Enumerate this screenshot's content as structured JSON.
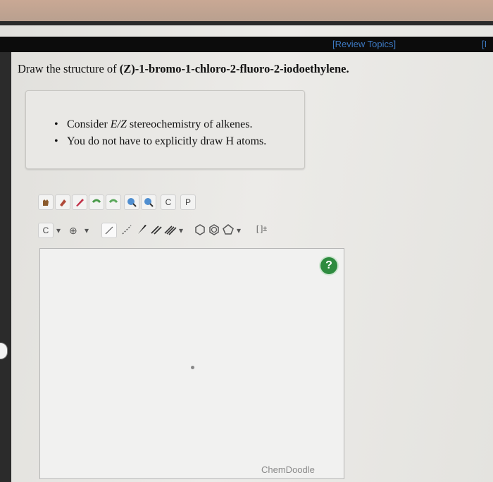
{
  "header": {
    "review_topics": "[Review Topics]",
    "edge_text": "[I"
  },
  "question": {
    "prefix": "Draw the structure of ",
    "compound": "(Z)-1-bromo-1-chloro-2-fluoro-2-iodoethylene."
  },
  "hints": [
    {
      "pre": "Consider ",
      "em": "E/Z",
      "post": " stereochemistry of alkenes."
    },
    {
      "pre": "You do not have to explicitly draw H atoms.",
      "em": "",
      "post": ""
    }
  ],
  "toolbar": {
    "row1": [
      "hand-icon",
      "eraser-icon",
      "pencil-icon",
      "undo-icon",
      "redo-icon",
      "zoom-in-icon",
      "zoom-out-icon",
      "copy-icon",
      "paste-icon"
    ],
    "copy_label": "C",
    "paste_label": "P",
    "carbon_label": "C",
    "charge_label": "⊕",
    "bracket_label": "[ ]±"
  },
  "canvas": {
    "help_label": "?",
    "brand": "ChemDoodle"
  },
  "colors": {
    "link": "#3c78c0",
    "help": "#2e8b3f"
  }
}
